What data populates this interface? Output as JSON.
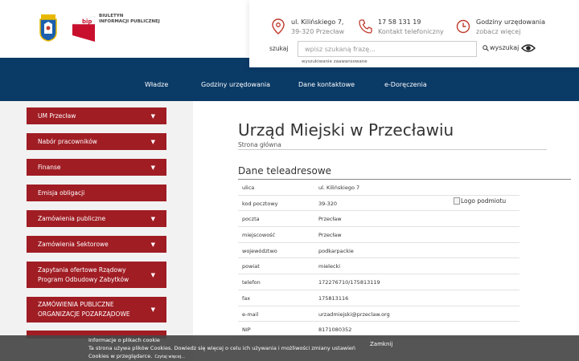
{
  "header": {
    "bip_text_line1": "Biuletyn",
    "bip_text_line2": "Informacji Publicznej",
    "bip_logo_text": "bip",
    "address": {
      "line1": "ul. Kilińskiego 7,",
      "line2": "39-320 Przecław"
    },
    "phone": {
      "line1": "17 58 131 19",
      "line2": "Kontakt telefoniczny"
    },
    "hours": {
      "line1": "Godziny urzędowania",
      "line2": "zobacz więcej"
    }
  },
  "search": {
    "label": "szukaj",
    "placeholder": "wpisz szukaną frazę...",
    "button": "wyszukaj",
    "advanced": "wyszukiwanie zaawansowane"
  },
  "nav": {
    "items": [
      "Władze",
      "Godziny urzędowania",
      "Dane kontaktowe",
      "e-Doręczenia"
    ]
  },
  "sidebar": {
    "items": [
      {
        "label": "UM Przecław",
        "arrow": "▼"
      },
      {
        "label": "Nabór pracowników",
        "arrow": "▼"
      },
      {
        "label": "Finanse",
        "arrow": "▼"
      },
      {
        "label": "Emisja obligacji",
        "arrow": ""
      },
      {
        "label": "Zamówienia publiczne",
        "arrow": "▼"
      },
      {
        "label": "Zamówienia Sektorowe",
        "arrow": "▼"
      },
      {
        "label": "Zapytania ofertowe Rządowy Program Odbudowy Zabytków",
        "arrow": "▼"
      },
      {
        "label": "ZAMÓWIENIA PUBLICZNE ORGANIZACJE POZARZĄDOWE",
        "arrow": "▼"
      }
    ]
  },
  "main": {
    "title": "Urząd Miejski w Przecławiu",
    "breadcrumb": "Strona główna",
    "section_title": "Dane teleadresowe",
    "logo_alt": "Logo podmiotu",
    "rows": [
      {
        "k": "ulica",
        "v": "ul. Kilińskiego 7"
      },
      {
        "k": "kod pocztowy",
        "v": "39-320"
      },
      {
        "k": "poczta",
        "v": "Przecław"
      },
      {
        "k": "miejscowość",
        "v": "Przecław"
      },
      {
        "k": "województwo",
        "v": "podkarpackie"
      },
      {
        "k": "powiat",
        "v": "mielecki"
      },
      {
        "k": "telefon",
        "v": "172276710/175813119"
      },
      {
        "k": "fax",
        "v": "175813116"
      },
      {
        "k": "e-mail",
        "v": "urzadmiejski@przeclaw.org"
      },
      {
        "k": "NIP",
        "v": "8171080352"
      }
    ]
  },
  "cookie": {
    "title": "Informacje o plikach cookie",
    "text": "Ta strona używa plików Cookies. Dowiedz się więcej o celu ich używania i możliwości zmiany ustawień",
    "text2": "Cookies w przeglądarce.",
    "more": "Czytaj więcej...",
    "close": "Zamknij"
  },
  "colors": {
    "navy": "#0a3a66",
    "sidebar_red": "#a01d24",
    "icon_red": "#c0392b"
  }
}
